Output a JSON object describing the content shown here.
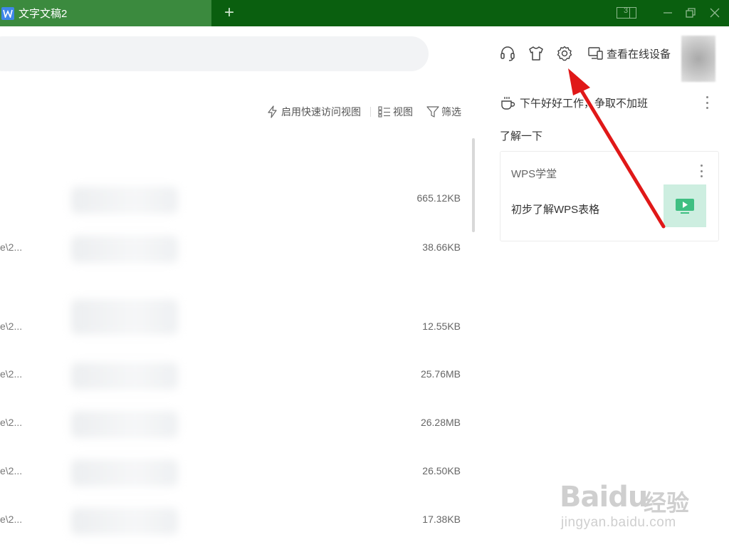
{
  "window": {
    "tab_title": "文字文稿2",
    "new_tab_symbol": "+",
    "layout_badge": "3"
  },
  "toolbar": {
    "icons": [
      "headset-icon",
      "skin-tshirt-icon",
      "settings-gear-icon"
    ],
    "devices_label": "查看在线设备"
  },
  "file_list": {
    "quick_access_label": "启用快速访问视图",
    "view_label": "视图",
    "filter_label": "筛选",
    "rows": [
      {
        "path": "",
        "size": "665.12KB"
      },
      {
        "path": "e\\2...",
        "size": "38.66KB"
      },
      {
        "path": "e\\2...",
        "size": "12.55KB"
      },
      {
        "path": "e\\2...",
        "size": "25.76MB"
      },
      {
        "path": "e\\2...",
        "size": "26.28MB"
      },
      {
        "path": "e\\2...",
        "size": "26.50KB"
      },
      {
        "path": "e\\2...",
        "size": "17.38KB"
      }
    ]
  },
  "right_panel": {
    "greeting": "下午好好工作，争取不加班",
    "learn_title": "了解一下",
    "card": {
      "header": "WPS学堂",
      "item": "初步了解WPS表格"
    }
  },
  "watermark": {
    "logo": "Baidu",
    "cn": "经验",
    "url": "jingyan.baidu.com"
  },
  "colors": {
    "titlebar": "#0a5f0f",
    "active_tab": "#3b8a3e",
    "arrow": "#e01818"
  }
}
